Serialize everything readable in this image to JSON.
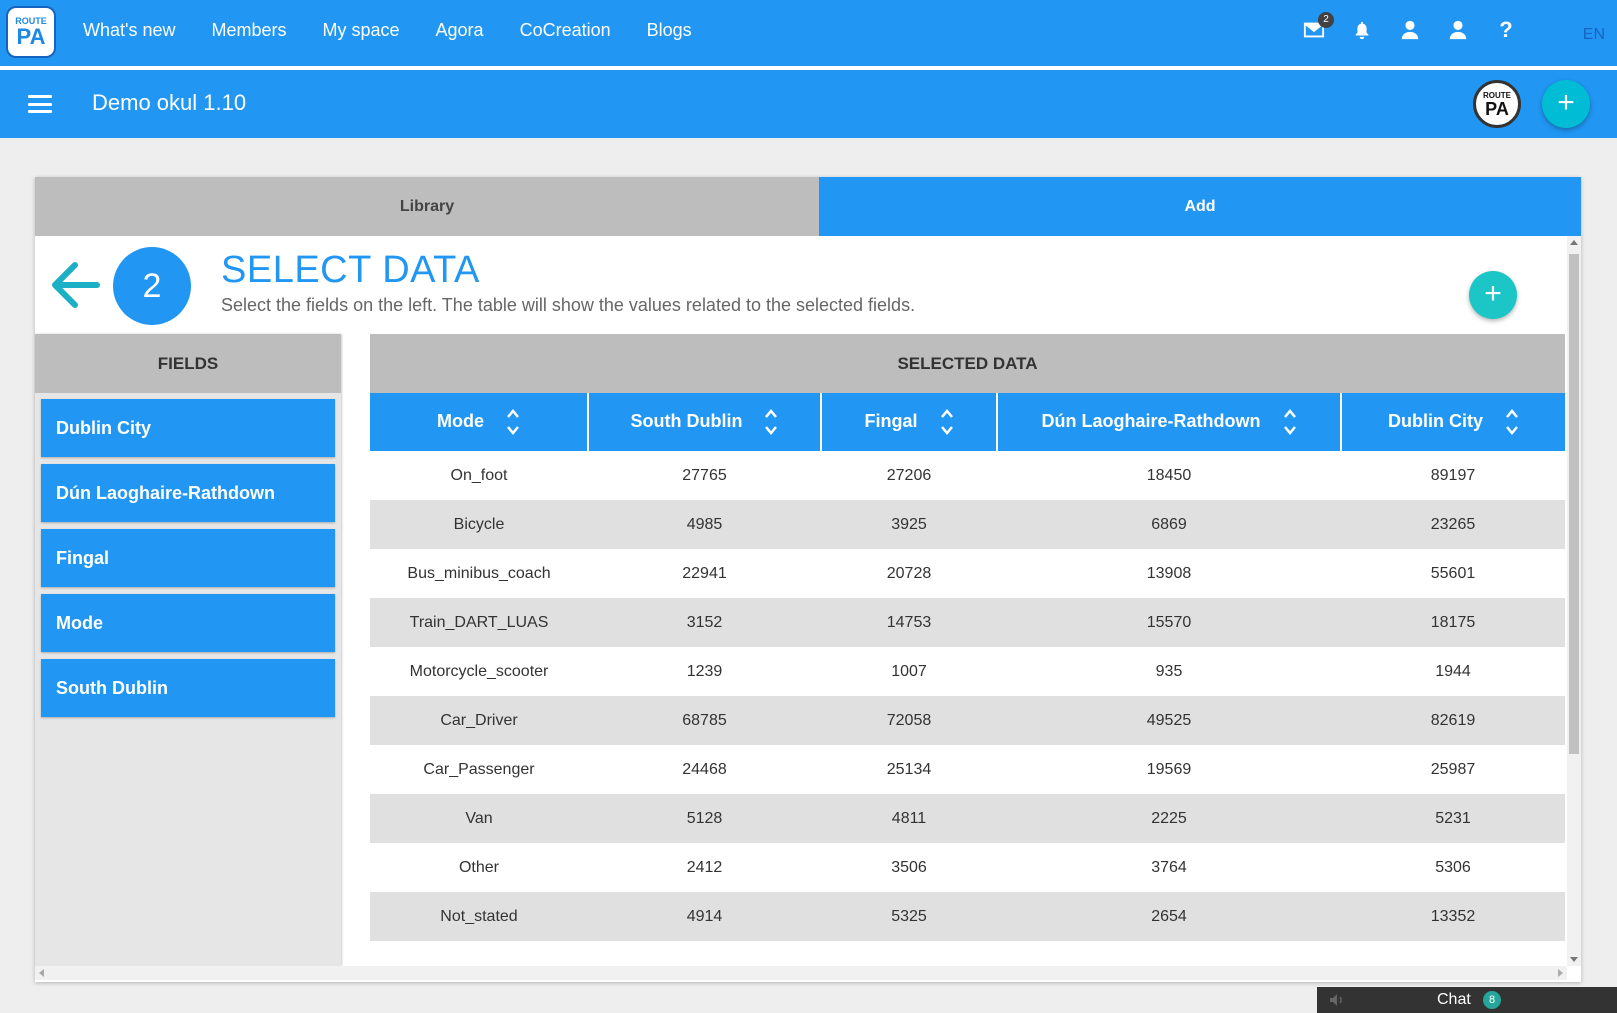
{
  "topnav": {
    "logo": {
      "line1": "ROUTE",
      "line2": "PA"
    },
    "links": [
      "What's new",
      "Members",
      "My space",
      "Agora",
      "CoCreation",
      "Blogs"
    ],
    "mail_badge": "2",
    "help": "?",
    "language": "EN"
  },
  "subbar": {
    "title": "Demo okul 1.10",
    "logo": {
      "line1": "ROUTE",
      "line2": "PA"
    },
    "add_label": "+"
  },
  "tabs": {
    "library": "Library",
    "add": "Add"
  },
  "step": {
    "number": "2",
    "title": "SELECT DATA",
    "description": "Select the fields on the left. The table will show the values related to the selected fields.",
    "add_label": "+"
  },
  "fields": {
    "heading": "FIELDS",
    "items": [
      "Dublin City",
      "Dún Laoghaire-Rathdown",
      "Fingal",
      "Mode",
      "South Dublin"
    ]
  },
  "selected": {
    "heading": "SELECTED DATA",
    "columns": [
      "Mode",
      "South Dublin",
      "Fingal",
      "Dún Laoghaire-Rathdown",
      "Dublin City"
    ],
    "rows": [
      [
        "On_foot",
        "27765",
        "27206",
        "18450",
        "89197"
      ],
      [
        "Bicycle",
        "4985",
        "3925",
        "6869",
        "23265"
      ],
      [
        "Bus_minibus_coach",
        "22941",
        "20728",
        "13908",
        "55601"
      ],
      [
        "Train_DART_LUAS",
        "3152",
        "14753",
        "15570",
        "18175"
      ],
      [
        "Motorcycle_scooter",
        "1239",
        "1007",
        "935",
        "1944"
      ],
      [
        "Car_Driver",
        "68785",
        "72058",
        "49525",
        "82619"
      ],
      [
        "Car_Passenger",
        "24468",
        "25134",
        "19569",
        "25987"
      ],
      [
        "Van",
        "5128",
        "4811",
        "2225",
        "5231"
      ],
      [
        "Other",
        "2412",
        "3506",
        "3764",
        "5306"
      ],
      [
        "Not_stated",
        "4914",
        "5325",
        "2654",
        "13352"
      ]
    ]
  },
  "chat": {
    "label": "Chat",
    "count": "8"
  },
  "colors": {
    "primary": "#2196f3",
    "accent": "#1cc6c6",
    "panel_gray": "#bdbdbd"
  }
}
